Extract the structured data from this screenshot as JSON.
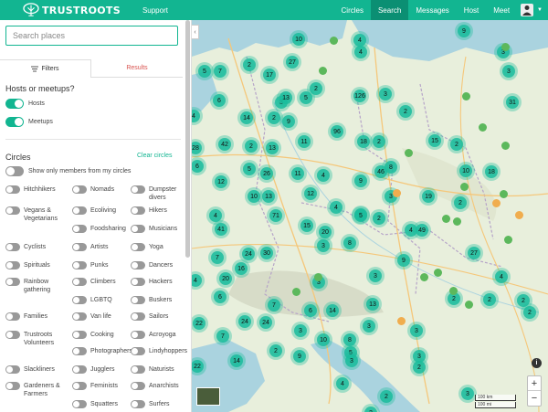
{
  "header": {
    "brand": "TRUSTROOTS",
    "support": "Support",
    "nav": [
      "Circles",
      "Search",
      "Messages",
      "Host",
      "Meet"
    ],
    "active_nav": "Search"
  },
  "sidebar": {
    "search_placeholder": "Search places",
    "tabs": {
      "filters": "Filters",
      "results": "Results"
    },
    "hosts_meetups_title": "Hosts or meetups?",
    "hosts_label": "Hosts",
    "meetups_label": "Meetups",
    "circles_title": "Circles",
    "clear_circles": "Clear circles",
    "show_only_members": "Show only members from my circles",
    "circles": [
      "Hitchhikers",
      "Nomads",
      "Dumpster divers",
      "Vegans & Vegetarians",
      "Ecoliving",
      "Hikers",
      "",
      "Foodsharing",
      "Musicians",
      "Cyclists",
      "Artists",
      "Yoga",
      "Spirituals",
      "Punks",
      "Dancers",
      "Rainbow gathering",
      "Climbers",
      "Hackers",
      "",
      "LGBTQ",
      "Buskers",
      "Families",
      "Van life",
      "Sailors",
      "Trustroots Volunteers",
      "Cooking",
      "Acroyoga",
      "",
      "Photographers",
      "Lindyhoppers",
      "Slackliners",
      "Jugglers",
      "Naturists",
      "Gardeners & Farmers",
      "Feminists",
      "Anarchists",
      "",
      "Squatters",
      "Surfers"
    ]
  },
  "map": {
    "markers": [
      "10",
      "4",
      "9",
      "3",
      "27",
      "5",
      "7",
      "2",
      "17",
      "3",
      "6",
      "3",
      "13",
      "5",
      "2",
      "126",
      "3",
      "2",
      "4",
      "31",
      "4",
      "14",
      "2",
      "9",
      "42",
      "2",
      "13",
      "96",
      "18",
      "2",
      "15",
      "2",
      "6",
      "11",
      "5",
      "28",
      "8",
      "26",
      "11",
      "4",
      "9",
      "46",
      "10",
      "18",
      "12",
      "10",
      "13",
      "12",
      "4",
      "2",
      "3",
      "19",
      "2",
      "4",
      "71",
      "15",
      "5",
      "2",
      "4",
      "41",
      "20",
      "49",
      "8",
      "3",
      "24",
      "30",
      "7",
      "16",
      "9",
      "27",
      "4",
      "20",
      "3",
      "3",
      "4",
      "2",
      "6",
      "13",
      "2",
      "24",
      "7",
      "6",
      "14",
      "2",
      "3",
      "22",
      "24",
      "3",
      "3",
      "2",
      "10",
      "8",
      "7",
      "2",
      "9",
      "5",
      "3",
      "2",
      "14",
      "22",
      "4",
      "2",
      "3",
      "3",
      "2"
    ],
    "scale_labels": [
      "100 km",
      "100 mi"
    ],
    "zoom_in": "+",
    "zoom_out": "−",
    "info_icon": "i",
    "colors": {
      "brand": "#12b591",
      "marker": "#1abc9c",
      "host_dot": "#5cb85c",
      "meet_dot": "#f0ad4e"
    }
  }
}
